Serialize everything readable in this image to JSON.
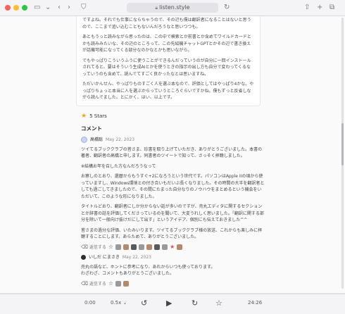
{
  "browser": {
    "url": "listen.style"
  },
  "article": {
    "paragraphs": [
      "ですよね。それでも仕事にならちゃうので、その辺も僕は翻訳者になることはないと思うので、ここまで追い込むこともないんだろうなと思いつつも。",
      "あともうっと読みながら思ったのは、この中で検索とか前書とか含めてワイルドカードとかも読みみたいな、その辺のところって、この先紹機チャットGPTとかその辺で書き換えが話機可能になってくる部分なのかなとかも思いながら。",
      "でもやっぱりこういうふうに使うことができるんだっていうのが自分に一回インストールされてると、要はそういう生成AIとかを使うときの指示の出し方も自分で変わってくるなっていうのも含めて、読んでてすごく良かったなとは思いますね。",
      "ただいかんせん、やっぱりものすごく人を選ぶ本なので、評価としてはやっぱり4かな。やっぱりちょっと本当に人を選ぶからっていうところぐらいですかね。僕もずっと反省しながら読んでました。とにかく、はい、以上です。"
    ]
  },
  "rating": {
    "label": "5 Stars"
  },
  "comments": {
    "title": "コメント",
    "items": [
      {
        "name": "高橋聡",
        "date": "May 22, 2023",
        "paragraphs": [
          "ツイてるブッククラブの皆さま、珍書を取り上げていただき、ありがとうございました。本書の著者、翻訳者の高橋と申します。同書者のツイートで知って、さっそく拝聴しました。",
          "※結構お年を召した方なんだろうなって",
          "お察しのとおり、還暦からもうすぐ+2になろうという世代です。パソコンはApple IIの頃から使っていますし、Windows環境との付き合いもだいぶ長くなりました。その時間の大半を翻訳者としても過ごしてきましたので、その間にたまった自分なりのノウハウをまとめるという機会をいただいて、このような形になりました。",
          "タイトルどおり、翻訳者にしか分からない話が多いのですが、売丸エディタに関するセクションとか辞書の話を評価してくださっているのを聞いて、大変うれしく思いました。「翻訳に関する部分を除いて一般向け抜けだにして出す」というアイデア、個別にも伝えておきました^^",
          "皆さまの過分な評価、いたみいります。ツイてるブッククラブ様の放送、これからも楽しみに拝聴することにします。あらためて、ありがとうございました。"
        ],
        "reaction_label": "返信する"
      },
      {
        "name": "いしだ にまさき",
        "date": "May 22, 2023",
        "paragraphs": [
          "売丸の語など、ホントに参考になり、あれからいつも使っております。",
          "わざわざ、コメントもありがとうございました。"
        ],
        "reaction_label": "返信する"
      }
    ]
  },
  "player": {
    "current_time": "0:00",
    "speed": "0.5x",
    "total_time": "24:26"
  },
  "icons": {
    "sidebar": "sidebar-icon",
    "back": "chevron-left-icon",
    "forward": "chevron-right-icon",
    "share": "share-icon",
    "add_tab": "plus-icon",
    "tabs": "tabs-icon",
    "rewind": "rewind-icon",
    "play": "play-icon",
    "forward_skip": "forward-icon",
    "favorite": "star-icon"
  }
}
